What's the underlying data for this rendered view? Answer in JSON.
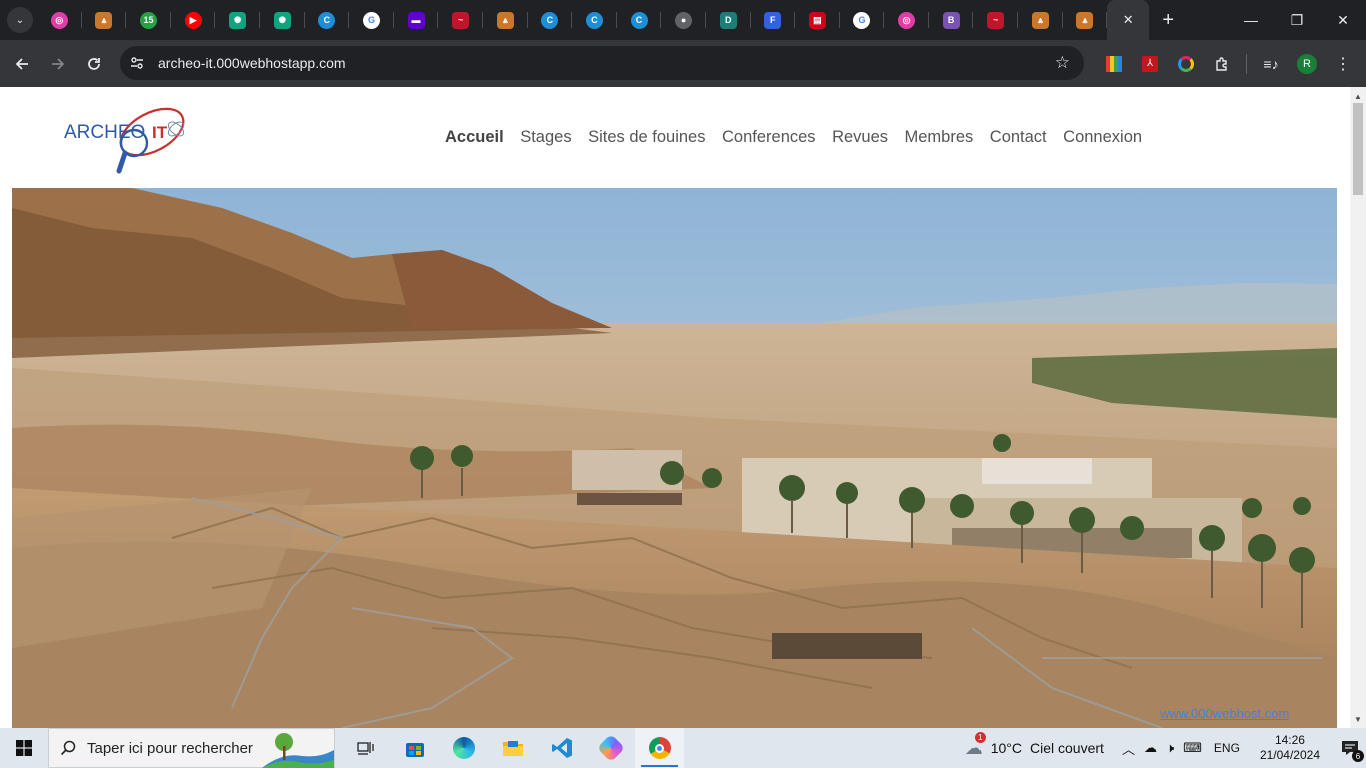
{
  "browser": {
    "tabs": [
      {
        "icon": "podium-icon",
        "color": "#e23ca7",
        "glyph": "◎"
      },
      {
        "icon": "archeo-tab-icon",
        "color": "#c8772b",
        "glyph": "⩓"
      },
      {
        "icon": "whatsapp-icon",
        "color": "#25a243",
        "glyph": "15"
      },
      {
        "icon": "youtube-icon",
        "color": "#ff0000",
        "glyph": "▶"
      },
      {
        "icon": "chatgpt-icon",
        "color": "#10a37f",
        "glyph": "✺"
      },
      {
        "icon": "chatgpt-icon",
        "color": "#10a37f",
        "glyph": "✺"
      },
      {
        "icon": "canva-icon",
        "color": "#1c8fd6",
        "glyph": "C"
      },
      {
        "icon": "google-icon",
        "color": "#ffffff",
        "glyph": "G"
      },
      {
        "icon": "yahoo-mail-icon",
        "color": "#6001d2",
        "glyph": "▬"
      },
      {
        "icon": "red-swirl-icon",
        "color": "#c0162c",
        "glyph": "~"
      },
      {
        "icon": "archeo-tab-icon",
        "color": "#c8772b",
        "glyph": "⩓"
      },
      {
        "icon": "canva-icon",
        "color": "#1c8fd6",
        "glyph": "C"
      },
      {
        "icon": "canva-icon",
        "color": "#1c8fd6",
        "glyph": "C"
      },
      {
        "icon": "canva-icon",
        "color": "#1c8fd6",
        "glyph": "C"
      },
      {
        "icon": "globe-icon",
        "color": "#5f6368",
        "glyph": "●"
      },
      {
        "icon": "d-icon",
        "color": "#1a7f78",
        "glyph": "D"
      },
      {
        "icon": "forms-icon",
        "color": "#2f63e0",
        "glyph": "F"
      },
      {
        "icon": "inscription-icon",
        "color": "#d0021b",
        "glyph": "▤"
      },
      {
        "icon": "google-icon",
        "color": "#ffffff",
        "glyph": "G"
      },
      {
        "icon": "podium-icon",
        "color": "#e23ca7",
        "glyph": "◎"
      },
      {
        "icon": "bootstrap-icon",
        "color": "#7952b3",
        "glyph": "B"
      },
      {
        "icon": "red-swirl-icon",
        "color": "#c0162c",
        "glyph": "~"
      },
      {
        "icon": "archeo-tab-icon",
        "color": "#c8772b",
        "glyph": "⩓"
      },
      {
        "icon": "archeo-tab-icon",
        "color": "#c8772b",
        "glyph": "⩓"
      }
    ],
    "active_tab_close": "✕",
    "new_tab": "+",
    "window_controls": {
      "minimize": "—",
      "restore": "❐",
      "close": "✕"
    },
    "url": "archeo-it.000webhostapp.com",
    "profile_initial": "R"
  },
  "site": {
    "logo": {
      "text": "ARCHEO",
      "accent": "IT"
    },
    "nav": [
      {
        "label": "Accueil",
        "active": true
      },
      {
        "label": "Stages"
      },
      {
        "label": "Sites de fouines"
      },
      {
        "label": "Conferences"
      },
      {
        "label": "Revues"
      },
      {
        "label": "Membres"
      },
      {
        "label": "Contact"
      },
      {
        "label": "Connexion"
      }
    ],
    "footer_badge": "www.000webhost.com"
  },
  "taskbar": {
    "search_placeholder": "Taper ici pour rechercher",
    "weather": {
      "temp": "10°C",
      "condition": "Ciel couvert",
      "alert_count": "1"
    },
    "language": "ENG",
    "time": "14:26",
    "date": "21/04/2024",
    "notification_count": "6"
  },
  "colors": {
    "chrome_dark": "#202124",
    "toolbar": "#35363a",
    "logo_blue": "#2f5aa8",
    "logo_red": "#c8312b",
    "taskbar": "#dfe6ee"
  }
}
